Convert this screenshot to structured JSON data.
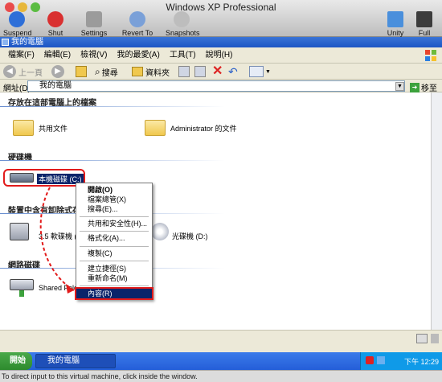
{
  "host": {
    "title": "Windows XP Professional",
    "buttons": {
      "suspend": "Suspend",
      "shutdown": "Shut Down",
      "settings": "Settings",
      "revert": "Revert To Snapshot",
      "snapshots": "Snapshots",
      "unity": "Unity",
      "fullscreen": "Full Screen"
    },
    "status_text": "To direct input to this virtual machine, click inside the window."
  },
  "window": {
    "title": "我的電腦",
    "menu": [
      "檔案(F)",
      "編輯(E)",
      "檢視(V)",
      "我的最愛(A)",
      "工具(T)",
      "說明(H)"
    ],
    "toolbar": {
      "back": "上一頁",
      "search": "搜尋",
      "folders": "資料夾"
    },
    "address": {
      "label": "網址(D)",
      "value": "我的電腦",
      "go": "移至"
    }
  },
  "content": {
    "sections": {
      "files": "存放在這部電腦上的檔案",
      "hdd": "硬碟機",
      "removable": "裝置中含有卸除式存放",
      "network": "網路磁碟"
    },
    "items": {
      "shared_docs": "共用文件",
      "admin_docs": "Administrator 的文件",
      "local_disk": "本機磁碟 (C:)",
      "floppy": "3.5 軟碟機 (A:)",
      "cd_drive": "光碟機 (D:)",
      "shared_folder": "Shared Fold..."
    }
  },
  "context_menu": {
    "items": [
      "開啟(O)",
      "檔案總管(X)",
      "搜尋(E)...",
      "共用和安全性(H)...",
      "格式化(A)...",
      "複製(C)",
      "建立捷徑(S)",
      "重新命名(M)",
      "內容(R)"
    ],
    "highlighted_index": 8
  },
  "taskbar": {
    "start": "開始",
    "task": "我的電腦",
    "clock": "下午 12:29"
  },
  "colors": {
    "xp_title": "#1c55c4",
    "highlight": "#0a246a",
    "annotation_red": "#e21b1b"
  }
}
